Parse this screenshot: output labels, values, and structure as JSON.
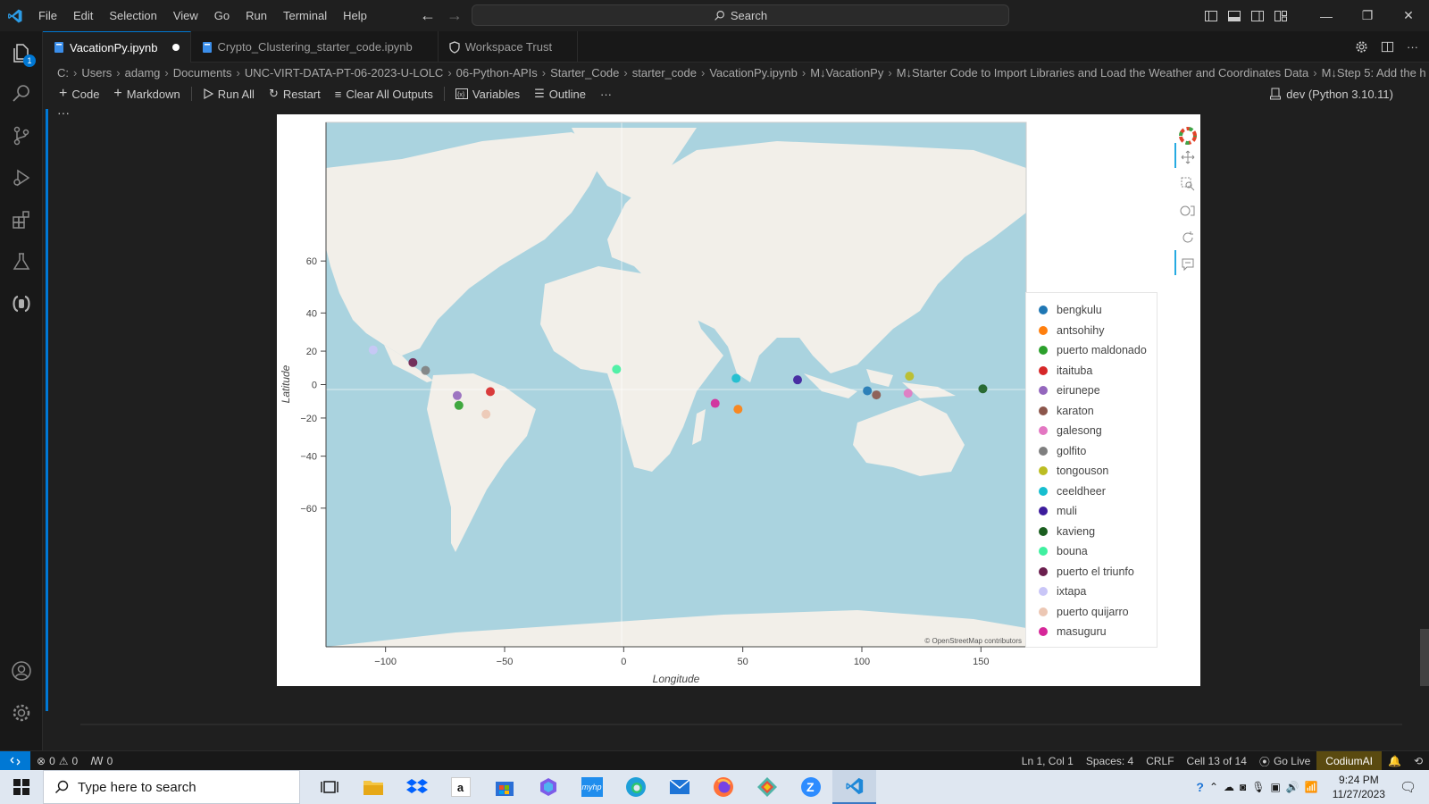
{
  "menu": [
    "File",
    "Edit",
    "Selection",
    "View",
    "Go",
    "Run",
    "Terminal",
    "Help"
  ],
  "search_label": "Search",
  "activity_badge": "1",
  "tabs": [
    {
      "label": "VacationPy.ipynb",
      "active": true,
      "dirty": true
    },
    {
      "label": "Crypto_Clustering_starter_code.ipynb",
      "active": false
    },
    {
      "label": "Workspace Trust",
      "active": false
    }
  ],
  "breadcrumb": [
    "C:",
    "Users",
    "adamg",
    "Documents",
    "UNC-VIRT-DATA-PT-06-2023-U-LOLC",
    "06-Python-APIs",
    "Starter_Code",
    "starter_code",
    "VacationPy.ipynb",
    "M↓VacationPy",
    "M↓Starter Code to Import Libraries and Load the Weather and Coordinates Data",
    "M↓Step 5: Add the h"
  ],
  "toolbar": {
    "code": "Code",
    "markdown": "Markdown",
    "run_all": "Run All",
    "restart": "Restart",
    "clear_outputs": "Clear All Outputs",
    "variables": "Variables",
    "outline": "Outline",
    "more": "···",
    "kernel": "dev (Python 3.10.11)"
  },
  "cell_more": "···",
  "status": {
    "errors": "0",
    "warnings": "0",
    "ports": "0",
    "position": "Ln 1, Col 1",
    "spaces": "Spaces: 4",
    "eol": "CRLF",
    "cell": "Cell 13 of 14",
    "golive": "Go Live",
    "codium": "CodiumAI"
  },
  "taskbar": {
    "search_placeholder": "Type here to search",
    "time": "9:24 PM",
    "date": "11/27/2023"
  },
  "plot": {
    "attribution": "© OpenStreetMap contributors"
  },
  "chart_data": {
    "type": "scatter",
    "title": "",
    "xlabel": "Longitude",
    "ylabel": "Latitude",
    "xlim": [
      -125,
      169
    ],
    "ylim": [
      -83,
      83
    ],
    "x_ticks": [
      -100,
      -50,
      0,
      50,
      100,
      150
    ],
    "y_ticks": [
      -60,
      -40,
      -20,
      0,
      20,
      40,
      60
    ],
    "tile_source": "OpenStreetMap",
    "legend_position": "right",
    "series": [
      {
        "name": "bengkulu",
        "color": "#1f77b4",
        "x": 102.3,
        "y": -3.8
      },
      {
        "name": "antsohihy",
        "color": "#ff7f0e",
        "x": 48.0,
        "y": -14.9
      },
      {
        "name": "puerto maldonado",
        "color": "#2ca02c",
        "x": -69.2,
        "y": -12.6
      },
      {
        "name": "itaituba",
        "color": "#d62728",
        "x": -56.0,
        "y": -4.3
      },
      {
        "name": "eirunepe",
        "color": "#9467bd",
        "x": -69.9,
        "y": -6.7
      },
      {
        "name": "karaton",
        "color": "#8c564b",
        "x": 106.1,
        "y": -6.3
      },
      {
        "name": "galesong",
        "color": "#e377c2",
        "x": 119.4,
        "y": -5.3
      },
      {
        "name": "golfito",
        "color": "#7f7f7f",
        "x": -83.2,
        "y": 8.6
      },
      {
        "name": "tongouson",
        "color": "#bcbd22",
        "x": 120.0,
        "y": 5.1
      },
      {
        "name": "ceeldheer",
        "color": "#17becf",
        "x": 47.2,
        "y": 3.8
      },
      {
        "name": "muli",
        "color": "#3d1c9c",
        "x": 73.0,
        "y": 2.9
      },
      {
        "name": "kavieng",
        "color": "#1b5e20",
        "x": 150.8,
        "y": -2.6
      },
      {
        "name": "bouna",
        "color": "#40f0a0",
        "x": -3.0,
        "y": 9.3
      },
      {
        "name": "puerto el triunfo",
        "color": "#6b1f4e",
        "x": -88.5,
        "y": 13.3
      },
      {
        "name": "ixtapa",
        "color": "#c9c6f7",
        "x": -105.2,
        "y": 20.7
      },
      {
        "name": "puerto quijarro",
        "color": "#ecc7b4",
        "x": -57.8,
        "y": -17.8
      },
      {
        "name": "masuguru",
        "color": "#d62799",
        "x": 38.4,
        "y": -11.4
      }
    ]
  }
}
